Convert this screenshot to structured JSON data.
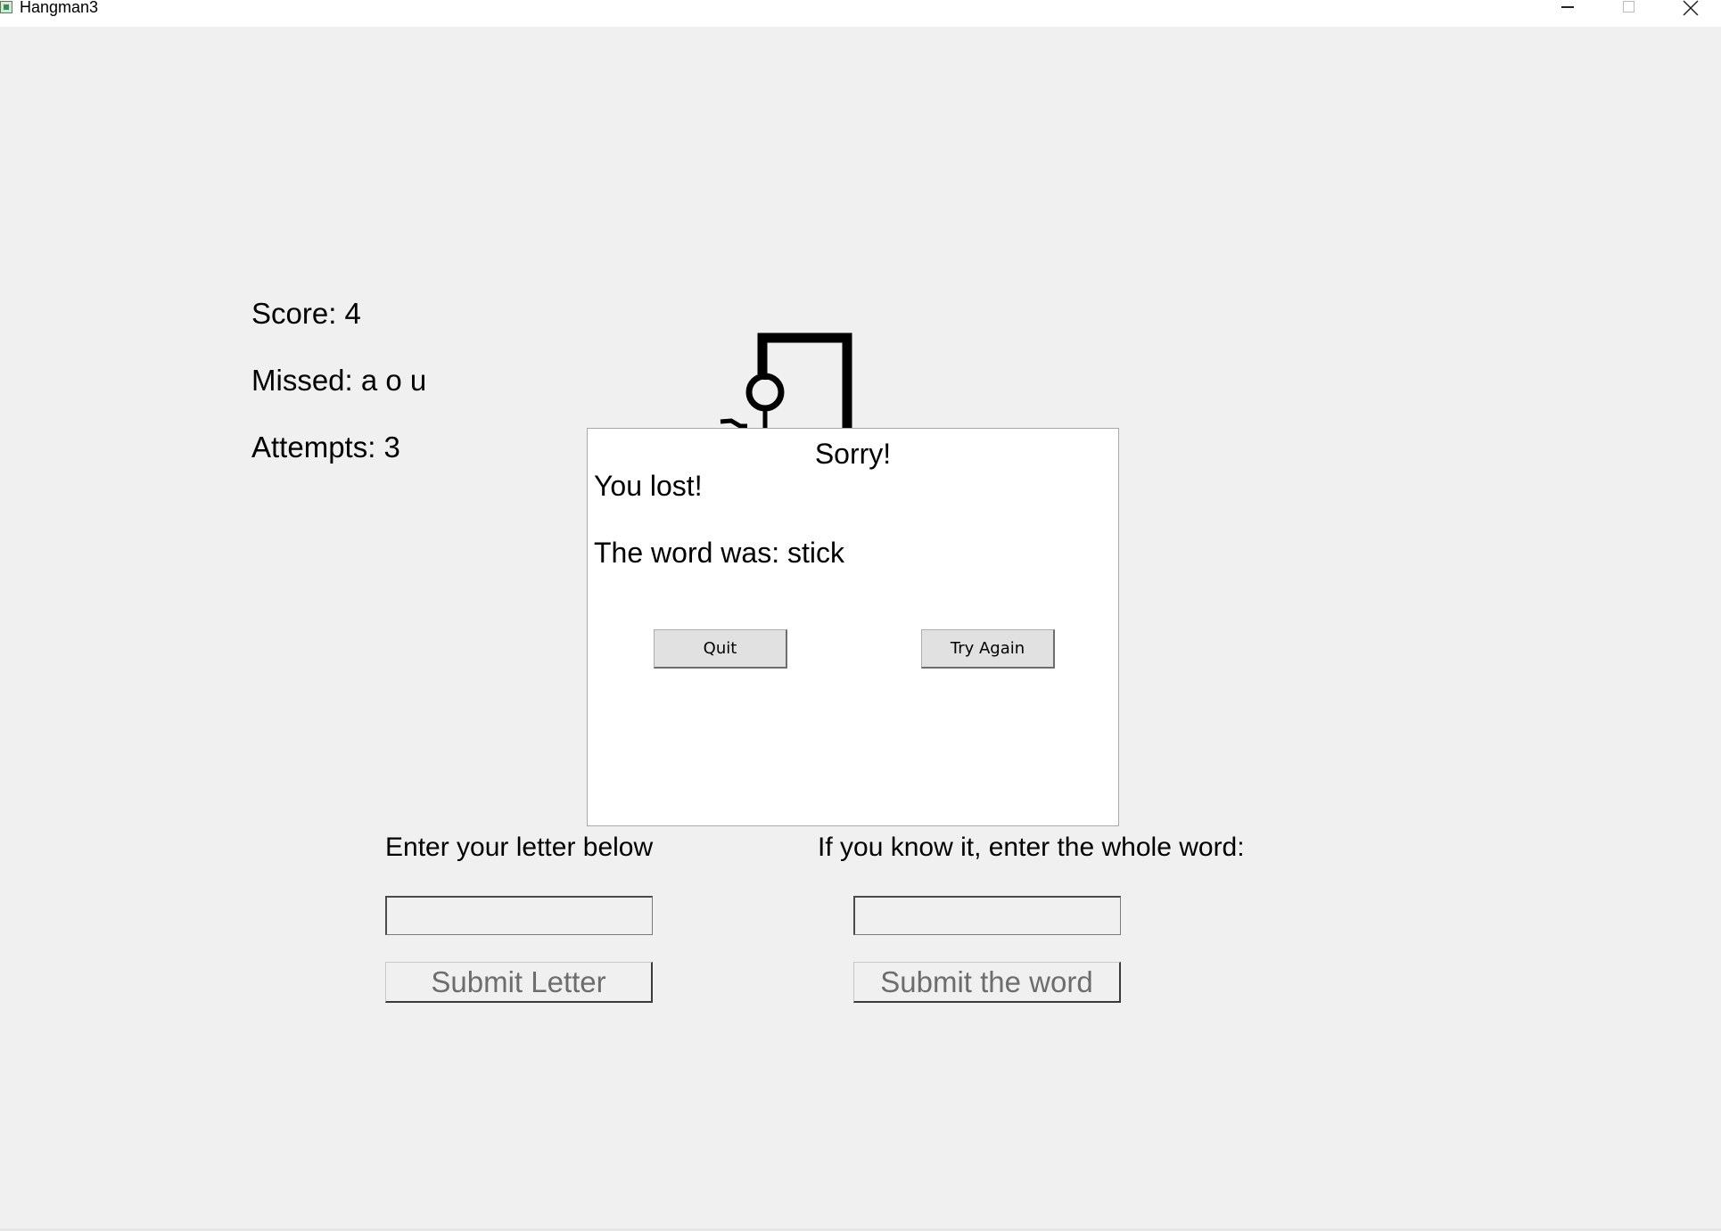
{
  "window": {
    "title": "Hangman3"
  },
  "stats": {
    "score": "Score: 4",
    "missed": "Missed: a o u",
    "attempts": "Attempts: 3"
  },
  "dialog": {
    "title": "Sorry!",
    "message": "You lost!",
    "word_reveal": "The word was: stick",
    "quit_label": "Quit",
    "try_again_label": "Try Again"
  },
  "letter_entry": {
    "label": "Enter your letter below",
    "value": "",
    "submit_label": "Submit Letter"
  },
  "word_entry": {
    "label": "If you know it, enter the whole word:",
    "value": "",
    "submit_label": "Submit the word"
  }
}
